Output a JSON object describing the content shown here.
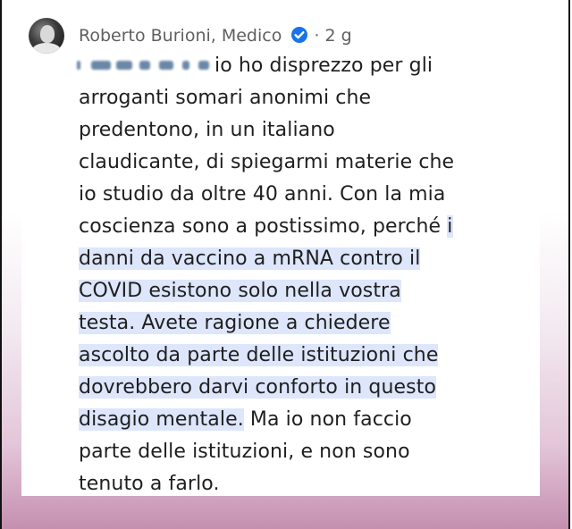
{
  "comment": {
    "author": "Roberto Burioni, Medico",
    "separator": "·",
    "time": "2 g",
    "lines": [
      {
        "before": "io ho disprezzo per gli",
        "highlight": "",
        "after": ""
      },
      {
        "before": "arroganti somari anonimi che",
        "highlight": "",
        "after": ""
      },
      {
        "before": "predentono, in un italiano",
        "highlight": "",
        "after": ""
      },
      {
        "before": "claudicante, di spiegarmi materie che",
        "highlight": "",
        "after": ""
      },
      {
        "before": "io studio da oltre 40 anni. Con la mia",
        "highlight": "",
        "after": ""
      },
      {
        "before": "coscienza sono a postissimo, perché ",
        "highlight": "i",
        "after": ""
      },
      {
        "before": "",
        "highlight": "danni da vaccino a mRNA contro il",
        "after": ""
      },
      {
        "before": "",
        "highlight": "COVID esistono solo nella vostra",
        "after": ""
      },
      {
        "before": "",
        "highlight": "testa. Avete ragione a chiedere",
        "after": ""
      },
      {
        "before": "",
        "highlight": "ascolto da parte delle istituzioni che",
        "after": ""
      },
      {
        "before": "",
        "highlight": "dovrebbero darvi conforto in questo",
        "after": ""
      },
      {
        "before": "",
        "highlight": "disagio mentale.",
        "after": " Ma io non faccio"
      },
      {
        "before": "parte delle istituzioni, e non sono",
        "highlight": "",
        "after": ""
      },
      {
        "before": "tenuto a farlo.",
        "highlight": "",
        "after": ""
      }
    ]
  },
  "icons": {
    "avatar": "profile-photo",
    "verified": "verified-badge-icon"
  },
  "colors": {
    "highlight": "#dde6fb",
    "verified": "#1a73e8",
    "text": "#1f1f1f",
    "meta": "#5f5f5f"
  }
}
